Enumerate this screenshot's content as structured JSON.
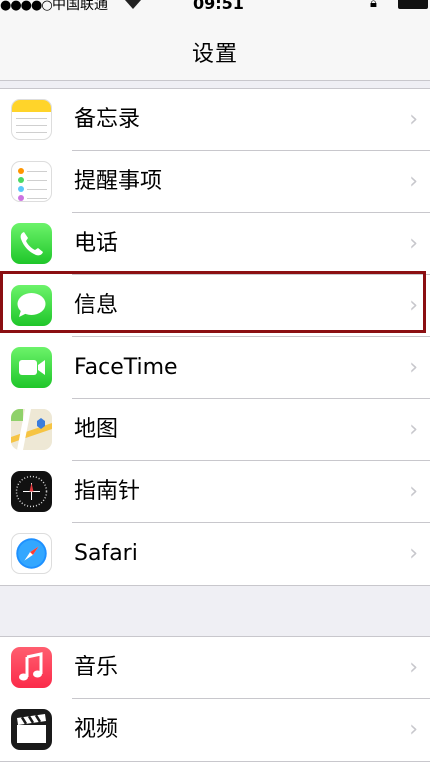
{
  "status_bar": {
    "signal": "●●●●○",
    "carrier": "中国联通",
    "time": "09:51"
  },
  "nav": {
    "title": "设置"
  },
  "group1": [
    {
      "label": "备忘录",
      "icon": "notes-icon"
    },
    {
      "label": "提醒事项",
      "icon": "reminders-icon"
    },
    {
      "label": "电话",
      "icon": "phone-icon"
    },
    {
      "label": "信息",
      "icon": "messages-icon"
    },
    {
      "label": "FaceTime",
      "icon": "facetime-icon"
    },
    {
      "label": "地图",
      "icon": "maps-icon"
    },
    {
      "label": "指南针",
      "icon": "compass-icon"
    },
    {
      "label": "Safari",
      "icon": "safari-icon"
    }
  ],
  "group2": [
    {
      "label": "音乐",
      "icon": "music-icon"
    },
    {
      "label": "视频",
      "icon": "videos-icon"
    }
  ],
  "chevron": "›",
  "colors": {
    "highlight": "#8b0f12",
    "green": "#1fc62a"
  }
}
